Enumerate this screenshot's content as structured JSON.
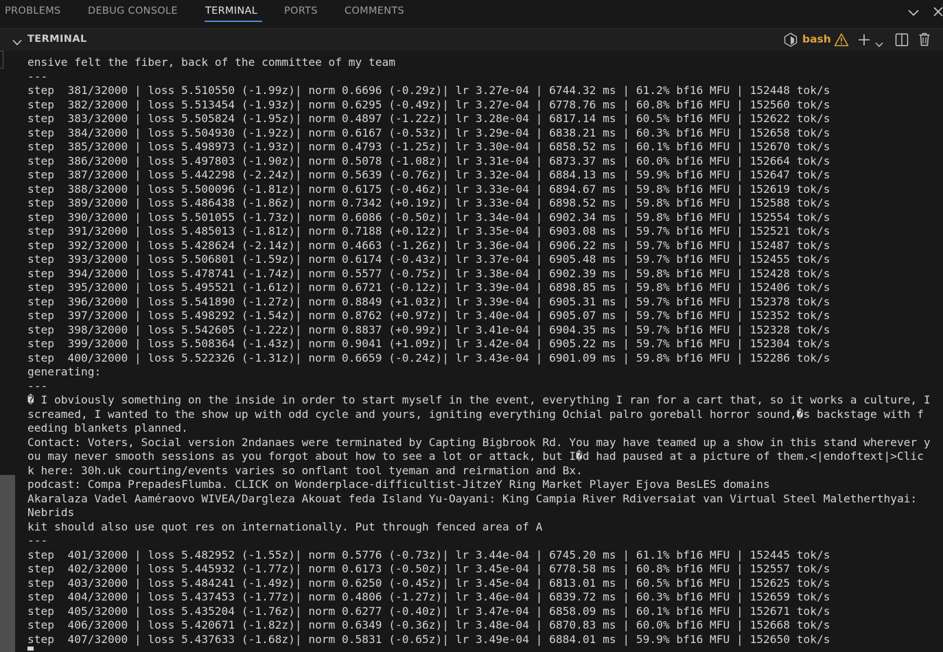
{
  "panel": {
    "tabs": [
      {
        "label": "PROBLEMS"
      },
      {
        "label": "DEBUG CONSOLE"
      },
      {
        "label": "TERMINAL"
      },
      {
        "label": "PORTS"
      },
      {
        "label": "COMMENTS"
      }
    ],
    "active_tab": "TERMINAL",
    "icons": [
      "chevron-down-icon",
      "close-icon"
    ]
  },
  "terminal": {
    "title": "TERMINAL",
    "shell_label": "bash",
    "header_icons": [
      "terminal-shell-icon",
      "warning-icon",
      "new-terminal-plus-icon",
      "terminal-dropdown-icon",
      "split-terminal-icon",
      "trash-icon"
    ],
    "accent_color": "#e2a23c",
    "lines": [
      "ensive felt the fiber, back of the committee of my team",
      "---",
      "step  381/32000 | loss 5.510550 (-1.99z)| norm 0.6696 (-0.29z)| lr 3.27e-04 | 6744.32 ms | 61.2% bf16 MFU | 152448 tok/s",
      "step  382/32000 | loss 5.513454 (-1.93z)| norm 0.6295 (-0.49z)| lr 3.27e-04 | 6778.76 ms | 60.8% bf16 MFU | 152560 tok/s",
      "step  383/32000 | loss 5.505824 (-1.95z)| norm 0.4897 (-1.22z)| lr 3.28e-04 | 6817.14 ms | 60.5% bf16 MFU | 152622 tok/s",
      "step  384/32000 | loss 5.504930 (-1.92z)| norm 0.6167 (-0.53z)| lr 3.29e-04 | 6838.21 ms | 60.3% bf16 MFU | 152658 tok/s",
      "step  385/32000 | loss 5.498973 (-1.93z)| norm 0.4793 (-1.25z)| lr 3.30e-04 | 6858.52 ms | 60.1% bf16 MFU | 152670 tok/s",
      "step  386/32000 | loss 5.497803 (-1.90z)| norm 0.5078 (-1.08z)| lr 3.31e-04 | 6873.37 ms | 60.0% bf16 MFU | 152664 tok/s",
      "step  387/32000 | loss 5.442298 (-2.24z)| norm 0.5639 (-0.76z)| lr 3.32e-04 | 6884.13 ms | 59.9% bf16 MFU | 152647 tok/s",
      "step  388/32000 | loss 5.500096 (-1.81z)| norm 0.6175 (-0.46z)| lr 3.33e-04 | 6894.67 ms | 59.8% bf16 MFU | 152619 tok/s",
      "step  389/32000 | loss 5.486438 (-1.86z)| norm 0.7342 (+0.19z)| lr 3.33e-04 | 6898.52 ms | 59.8% bf16 MFU | 152588 tok/s",
      "step  390/32000 | loss 5.501055 (-1.73z)| norm 0.6086 (-0.50z)| lr 3.34e-04 | 6902.34 ms | 59.8% bf16 MFU | 152554 tok/s",
      "step  391/32000 | loss 5.485013 (-1.81z)| norm 0.7188 (+0.12z)| lr 3.35e-04 | 6903.08 ms | 59.7% bf16 MFU | 152521 tok/s",
      "step  392/32000 | loss 5.428624 (-2.14z)| norm 0.4663 (-1.26z)| lr 3.36e-04 | 6906.22 ms | 59.7% bf16 MFU | 152487 tok/s",
      "step  393/32000 | loss 5.506801 (-1.59z)| norm 0.6174 (-0.43z)| lr 3.37e-04 | 6905.48 ms | 59.7% bf16 MFU | 152455 tok/s",
      "step  394/32000 | loss 5.478741 (-1.74z)| norm 0.5577 (-0.75z)| lr 3.38e-04 | 6902.39 ms | 59.8% bf16 MFU | 152428 tok/s",
      "step  395/32000 | loss 5.495521 (-1.61z)| norm 0.6721 (-0.12z)| lr 3.39e-04 | 6898.85 ms | 59.8% bf16 MFU | 152406 tok/s",
      "step  396/32000 | loss 5.541890 (-1.27z)| norm 0.8849 (+1.03z)| lr 3.39e-04 | 6905.31 ms | 59.7% bf16 MFU | 152378 tok/s",
      "step  397/32000 | loss 5.498292 (-1.54z)| norm 0.8762 (+0.97z)| lr 3.40e-04 | 6905.07 ms | 59.7% bf16 MFU | 152352 tok/s",
      "step  398/32000 | loss 5.542605 (-1.22z)| norm 0.8837 (+0.99z)| lr 3.41e-04 | 6904.35 ms | 59.7% bf16 MFU | 152328 tok/s",
      "step  399/32000 | loss 5.508364 (-1.43z)| norm 0.9041 (+1.09z)| lr 3.42e-04 | 6905.22 ms | 59.7% bf16 MFU | 152304 tok/s",
      "step  400/32000 | loss 5.522326 (-1.31z)| norm 0.6659 (-0.24z)| lr 3.43e-04 | 6901.09 ms | 59.8% bf16 MFU | 152286 tok/s",
      "generating:",
      "---",
      "� I obviously something on the inside in order to start myself in the event, everything I ran for a cart that, so it works a culture, I",
      "screamed, I wanted to the show up with odd cycle and yours, igniting everything Ochial palro goreball horror sound,�s backstage with f",
      "eeding blankets planned.",
      "Contact: Voters, Social version 2ndanaes were terminated by Capting Bigbrook Rd. You may have teamed up a show in this stand wherever y",
      "ou may never smooth sessions as you forgot about how to see a lot or attack, but I�d had paused at a picture of them.<|endoftext|>Clic",
      "k here: 30h.uk courting/events varies so onflant tool tyeman and reirmation and Bx.",
      "podcast: Compa PrepadesFlumba. CLICK on Wonderplace-difficultist-JitzeY Ring Market Player Ejova BesLES domains",
      "Akaralaza Vadel Aaméraovo WIVEA/Dargleza Akouat feda Island Yu-Oayani: King Campia River Rdiversaiat van Virtual Steel Maletherthyai: ",
      "Nebrids",
      "kit should also use quot res on internationally. Put through fenced area of A",
      "---",
      "step  401/32000 | loss 5.482952 (-1.55z)| norm 0.5776 (-0.73z)| lr 3.44e-04 | 6745.20 ms | 61.1% bf16 MFU | 152445 tok/s",
      "step  402/32000 | loss 5.445932 (-1.77z)| norm 0.6173 (-0.50z)| lr 3.45e-04 | 6778.58 ms | 60.8% bf16 MFU | 152557 tok/s",
      "step  403/32000 | loss 5.484241 (-1.49z)| norm 0.6250 (-0.45z)| lr 3.45e-04 | 6813.01 ms | 60.5% bf16 MFU | 152625 tok/s",
      "step  404/32000 | loss 5.437453 (-1.77z)| norm 0.4806 (-1.27z)| lr 3.46e-04 | 6839.72 ms | 60.3% bf16 MFU | 152659 tok/s",
      "step  405/32000 | loss 5.435204 (-1.76z)| norm 0.6277 (-0.40z)| lr 3.47e-04 | 6858.09 ms | 60.1% bf16 MFU | 152671 tok/s",
      "step  406/32000 | loss 5.420671 (-1.82z)| norm 0.6349 (-0.36z)| lr 3.48e-04 | 6870.83 ms | 60.0% bf16 MFU | 152668 tok/s",
      "step  407/32000 | loss 5.437633 (-1.68z)| norm 0.5831 (-0.65z)| lr 3.49e-04 | 6884.01 ms | 59.9% bf16 MFU | 152650 tok/s"
    ]
  }
}
